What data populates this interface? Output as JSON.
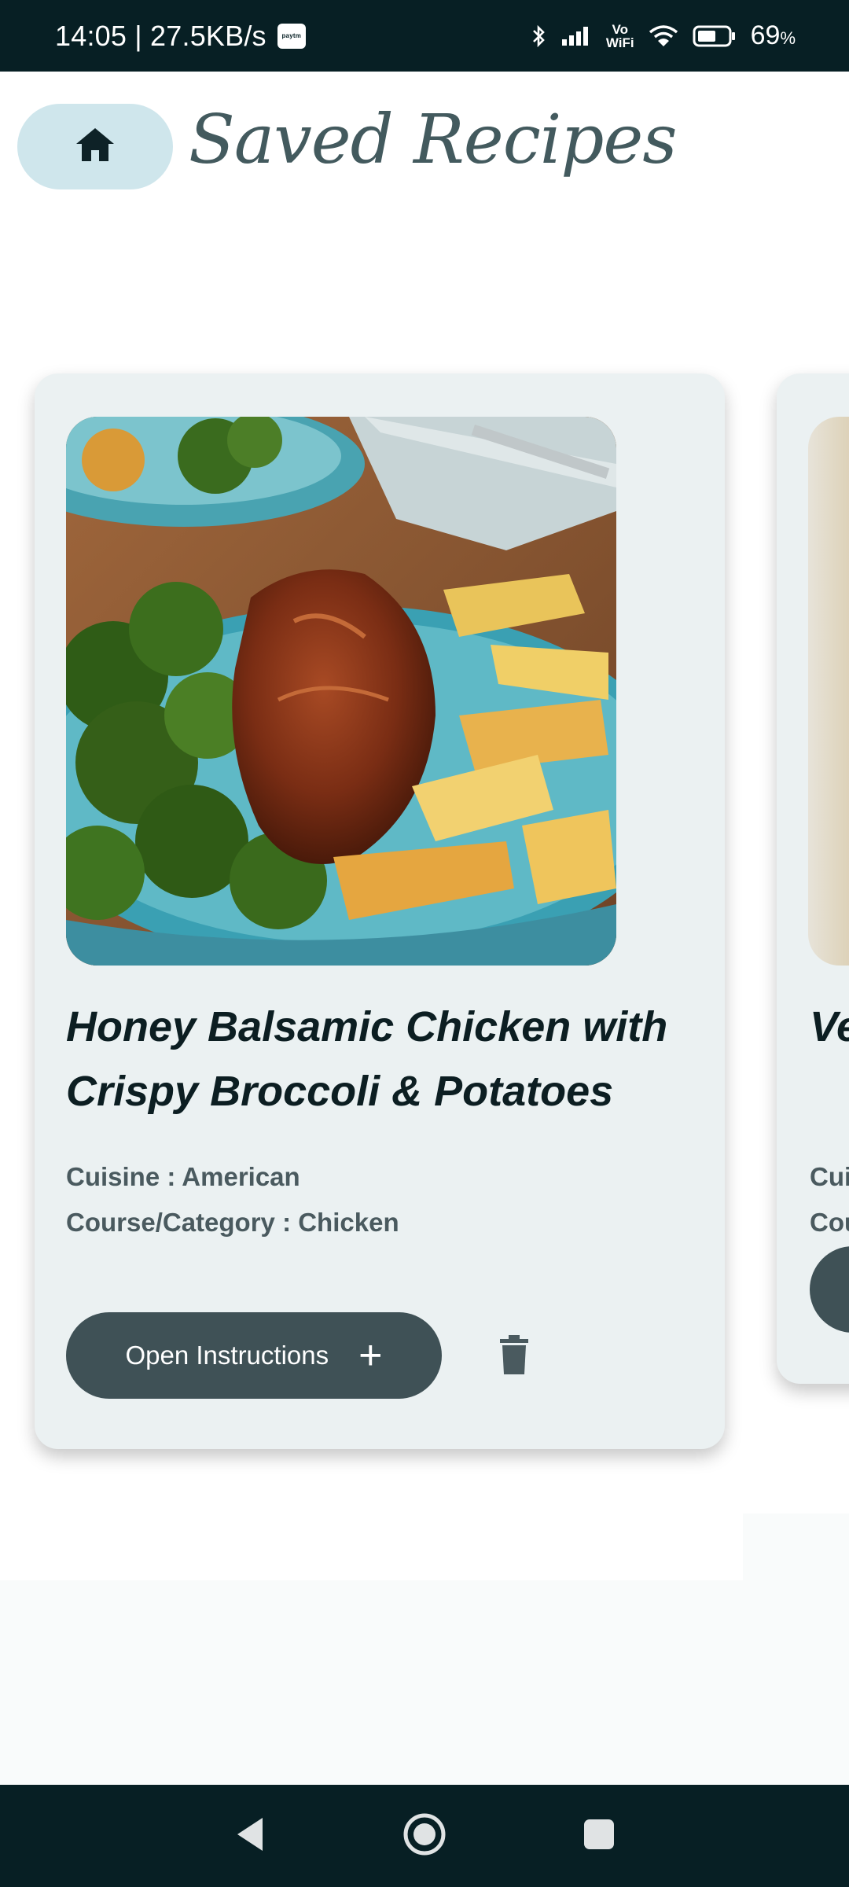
{
  "status_bar": {
    "time_speed": "14:05 | 27.5KB/s",
    "paytm_badge": "paytm",
    "vowifi_top": "Vo",
    "vowifi_bottom": "WiFi",
    "battery_percent": "69",
    "battery_unit": "%"
  },
  "header": {
    "title": "Saved Recipes",
    "home_icon": "home-icon"
  },
  "recipes": [
    {
      "title": "Honey Balsamic Chicken with Crispy Broccoli & Potatoes",
      "cuisine": "Cuisine : American",
      "course": "Course/Category : Chicken",
      "open_label": "Open Instructions",
      "plus_glyph": "+",
      "delete_icon": "trash-icon"
    },
    {
      "title_visible": "Ve",
      "cuisine_visible": "Cui",
      "course_visible": "Cou"
    }
  ],
  "nav": {
    "back_icon": "back-triangle-icon",
    "home_icon": "home-circle-icon",
    "recents_icon": "recents-square-icon"
  },
  "colors": {
    "status_bar_bg": "#071f24",
    "home_pill_bg": "#cfe6ec",
    "card_bg": "#ebf1f2",
    "button_bg": "#3f5156",
    "title_color": "#435a5e"
  }
}
